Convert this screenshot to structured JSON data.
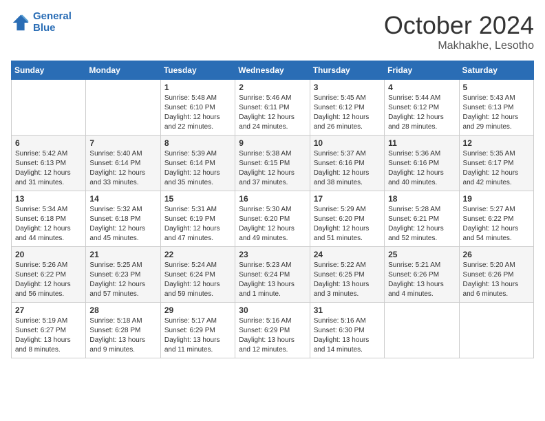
{
  "header": {
    "logo_line1": "General",
    "logo_line2": "Blue",
    "month": "October 2024",
    "location": "Makhakhe, Lesotho"
  },
  "days_of_week": [
    "Sunday",
    "Monday",
    "Tuesday",
    "Wednesday",
    "Thursday",
    "Friday",
    "Saturday"
  ],
  "weeks": [
    [
      {
        "day": "",
        "info": ""
      },
      {
        "day": "",
        "info": ""
      },
      {
        "day": "1",
        "info": "Sunrise: 5:48 AM\nSunset: 6:10 PM\nDaylight: 12 hours\nand 22 minutes."
      },
      {
        "day": "2",
        "info": "Sunrise: 5:46 AM\nSunset: 6:11 PM\nDaylight: 12 hours\nand 24 minutes."
      },
      {
        "day": "3",
        "info": "Sunrise: 5:45 AM\nSunset: 6:12 PM\nDaylight: 12 hours\nand 26 minutes."
      },
      {
        "day": "4",
        "info": "Sunrise: 5:44 AM\nSunset: 6:12 PM\nDaylight: 12 hours\nand 28 minutes."
      },
      {
        "day": "5",
        "info": "Sunrise: 5:43 AM\nSunset: 6:13 PM\nDaylight: 12 hours\nand 29 minutes."
      }
    ],
    [
      {
        "day": "6",
        "info": "Sunrise: 5:42 AM\nSunset: 6:13 PM\nDaylight: 12 hours\nand 31 minutes."
      },
      {
        "day": "7",
        "info": "Sunrise: 5:40 AM\nSunset: 6:14 PM\nDaylight: 12 hours\nand 33 minutes."
      },
      {
        "day": "8",
        "info": "Sunrise: 5:39 AM\nSunset: 6:14 PM\nDaylight: 12 hours\nand 35 minutes."
      },
      {
        "day": "9",
        "info": "Sunrise: 5:38 AM\nSunset: 6:15 PM\nDaylight: 12 hours\nand 37 minutes."
      },
      {
        "day": "10",
        "info": "Sunrise: 5:37 AM\nSunset: 6:16 PM\nDaylight: 12 hours\nand 38 minutes."
      },
      {
        "day": "11",
        "info": "Sunrise: 5:36 AM\nSunset: 6:16 PM\nDaylight: 12 hours\nand 40 minutes."
      },
      {
        "day": "12",
        "info": "Sunrise: 5:35 AM\nSunset: 6:17 PM\nDaylight: 12 hours\nand 42 minutes."
      }
    ],
    [
      {
        "day": "13",
        "info": "Sunrise: 5:34 AM\nSunset: 6:18 PM\nDaylight: 12 hours\nand 44 minutes."
      },
      {
        "day": "14",
        "info": "Sunrise: 5:32 AM\nSunset: 6:18 PM\nDaylight: 12 hours\nand 45 minutes."
      },
      {
        "day": "15",
        "info": "Sunrise: 5:31 AM\nSunset: 6:19 PM\nDaylight: 12 hours\nand 47 minutes."
      },
      {
        "day": "16",
        "info": "Sunrise: 5:30 AM\nSunset: 6:20 PM\nDaylight: 12 hours\nand 49 minutes."
      },
      {
        "day": "17",
        "info": "Sunrise: 5:29 AM\nSunset: 6:20 PM\nDaylight: 12 hours\nand 51 minutes."
      },
      {
        "day": "18",
        "info": "Sunrise: 5:28 AM\nSunset: 6:21 PM\nDaylight: 12 hours\nand 52 minutes."
      },
      {
        "day": "19",
        "info": "Sunrise: 5:27 AM\nSunset: 6:22 PM\nDaylight: 12 hours\nand 54 minutes."
      }
    ],
    [
      {
        "day": "20",
        "info": "Sunrise: 5:26 AM\nSunset: 6:22 PM\nDaylight: 12 hours\nand 56 minutes."
      },
      {
        "day": "21",
        "info": "Sunrise: 5:25 AM\nSunset: 6:23 PM\nDaylight: 12 hours\nand 57 minutes."
      },
      {
        "day": "22",
        "info": "Sunrise: 5:24 AM\nSunset: 6:24 PM\nDaylight: 12 hours\nand 59 minutes."
      },
      {
        "day": "23",
        "info": "Sunrise: 5:23 AM\nSunset: 6:24 PM\nDaylight: 13 hours\nand 1 minute."
      },
      {
        "day": "24",
        "info": "Sunrise: 5:22 AM\nSunset: 6:25 PM\nDaylight: 13 hours\nand 3 minutes."
      },
      {
        "day": "25",
        "info": "Sunrise: 5:21 AM\nSunset: 6:26 PM\nDaylight: 13 hours\nand 4 minutes."
      },
      {
        "day": "26",
        "info": "Sunrise: 5:20 AM\nSunset: 6:26 PM\nDaylight: 13 hours\nand 6 minutes."
      }
    ],
    [
      {
        "day": "27",
        "info": "Sunrise: 5:19 AM\nSunset: 6:27 PM\nDaylight: 13 hours\nand 8 minutes."
      },
      {
        "day": "28",
        "info": "Sunrise: 5:18 AM\nSunset: 6:28 PM\nDaylight: 13 hours\nand 9 minutes."
      },
      {
        "day": "29",
        "info": "Sunrise: 5:17 AM\nSunset: 6:29 PM\nDaylight: 13 hours\nand 11 minutes."
      },
      {
        "day": "30",
        "info": "Sunrise: 5:16 AM\nSunset: 6:29 PM\nDaylight: 13 hours\nand 12 minutes."
      },
      {
        "day": "31",
        "info": "Sunrise: 5:16 AM\nSunset: 6:30 PM\nDaylight: 13 hours\nand 14 minutes."
      },
      {
        "day": "",
        "info": ""
      },
      {
        "day": "",
        "info": ""
      }
    ]
  ]
}
